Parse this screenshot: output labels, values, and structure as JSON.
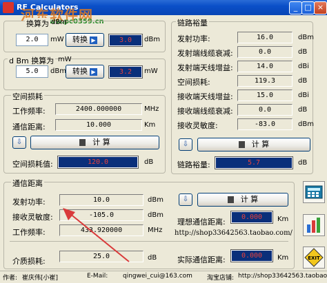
{
  "window": {
    "title": "RF Calculators",
    "watermark": "河东软件网",
    "watermark_url": "www.pc0359.cn",
    "minimize": "_",
    "maximize": "□",
    "close": "×"
  },
  "converter1": {
    "title": "换算为",
    "to_unit": "dBm",
    "input": "2.0",
    "input_unit": "mW",
    "button": "转换",
    "result": "3.0",
    "result_unit": "dBm"
  },
  "converter2": {
    "title": "d Bm 换算为",
    "to_unit": "mW",
    "input": "5.0",
    "input_unit": "dBm",
    "button": "转换",
    "result": "3.2",
    "result_unit": "mW"
  },
  "space_loss": {
    "title": "空间损耗",
    "freq_label": "工作频率:",
    "freq": "2400.000000",
    "freq_unit": "MHz",
    "dist_label": "通信距离:",
    "dist": "10.000",
    "dist_unit": "Km",
    "calc": "计   算",
    "result_label": "空间损耗值:",
    "result": "120.0",
    "result_unit": "dB"
  },
  "link_margin": {
    "title": "链路裕量",
    "rows": [
      {
        "label": "发射功率:",
        "value": "16.0",
        "unit": "dBm"
      },
      {
        "label": "发射端线缆衰减:",
        "value": "0.0",
        "unit": "dB"
      },
      {
        "label": "发射端天线增益:",
        "value": "14.0",
        "unit": "dBi"
      },
      {
        "label": "空间损耗:",
        "value": "119.3",
        "unit": "dB"
      },
      {
        "label": "接收端天线增益:",
        "value": "15.0",
        "unit": "dBi"
      },
      {
        "label": "接收端线缆衰减:",
        "value": "0.0",
        "unit": "dB"
      },
      {
        "label": "接收灵敏度:",
        "value": "-83.0",
        "unit": "dBm"
      }
    ],
    "calc": "计   算",
    "result_label": "链路裕量:",
    "result": "5.7",
    "result_unit": "dB"
  },
  "comm_distance": {
    "title": "通信距离",
    "tx_label": "发射功率:",
    "tx": "10.0",
    "tx_unit": "dBm",
    "rx_label": "接收灵敏度:",
    "rx": "-105.0",
    "rx_unit": "dBm",
    "freq_label": "工作频率:",
    "freq": "433.920000",
    "freq_unit": "MHz",
    "medium_label": "介质损耗:",
    "medium": "25.0",
    "medium_unit": "dB",
    "calc": "计   算",
    "ideal_label": "理想通信距离:",
    "ideal": "0.000",
    "ideal_unit": "Km",
    "url": "http://shop33642563.taobao.com/",
    "actual_label": "实际通信距离:",
    "actual": "0.000",
    "actual_unit": "Km"
  },
  "statusbar": {
    "author_label": "作者:",
    "author": "崔庆伟[小崔]",
    "email_label": "E-Mail:",
    "email": "qingwei_cui@163.com",
    "shop_label": "淘宝店铺:",
    "shop": "http://shop33642563.taobao.com"
  },
  "icons": [
    "calculator-icon",
    "chart-icon",
    "exit-icon",
    "arrow-right-icon",
    "down-arrow-icon"
  ],
  "colors": {
    "titlebar": "#0a4fc8",
    "result_bg": "#0a2f7a",
    "result_text": "#e7413c",
    "annotation_arrow": "#d93a3a"
  }
}
